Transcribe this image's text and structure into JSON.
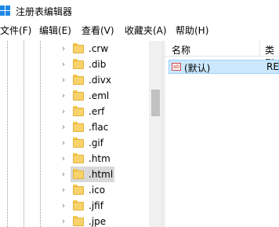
{
  "window": {
    "title": "注册表编辑器"
  },
  "menu": [
    "文件(F)",
    "编辑(E)",
    "查看(V)",
    "收藏夹(A)",
    "帮助(H)"
  ],
  "tree": {
    "items": [
      {
        "label": ".crw"
      },
      {
        "label": ".dib"
      },
      {
        "label": ".divx"
      },
      {
        "label": ".eml"
      },
      {
        "label": ".erf"
      },
      {
        "label": ".flac"
      },
      {
        "label": ".gif"
      },
      {
        "label": ".htm"
      },
      {
        "label": ".html",
        "selected": true
      },
      {
        "label": ".ico"
      },
      {
        "label": ".jfif"
      },
      {
        "label": ".jpe"
      }
    ]
  },
  "list": {
    "columns": {
      "name": "名称",
      "type": "类型"
    },
    "rows": [
      {
        "name": "(默认)",
        "type": "RE",
        "icon": "ab-string-icon"
      }
    ]
  }
}
